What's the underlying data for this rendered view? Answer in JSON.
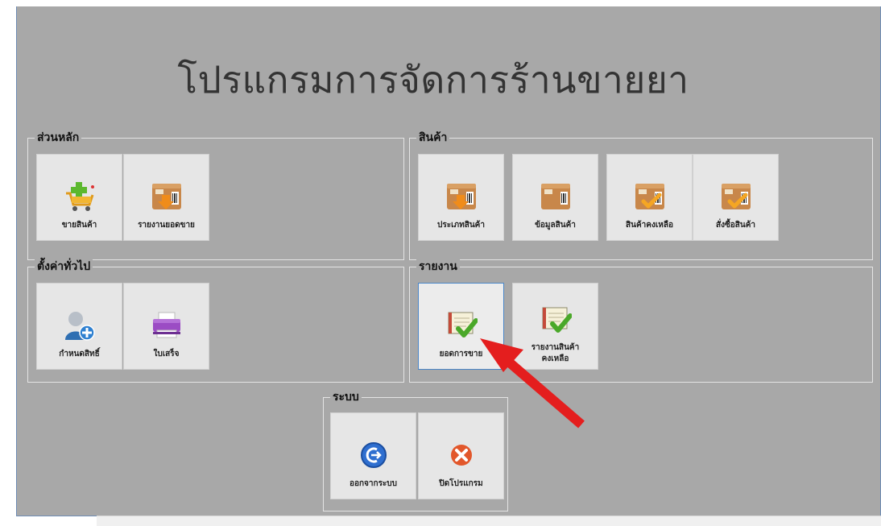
{
  "app": {
    "title": "โปรแกรมการจัดการร้านขายยา"
  },
  "groups": {
    "main": {
      "title": "ส่วนหลัก",
      "items": [
        {
          "label": "ขายสินค้า",
          "icon": "shopping-cart-add-icon"
        },
        {
          "label": "รายงานยอดขาย",
          "icon": "package-download-icon"
        }
      ]
    },
    "products": {
      "title": "สินค้า",
      "items": [
        {
          "label": "ประเภทสินค้า",
          "icon": "package-download-icon"
        },
        {
          "label": "ข้อมูลสินค้า",
          "icon": "package-icon"
        },
        {
          "label": "สินค้าคงเหลือ",
          "icon": "package-check-icon"
        },
        {
          "label": "สั่งซื้อสินค้า",
          "icon": "package-check-icon"
        }
      ]
    },
    "settings": {
      "title": "ตั้งค่าทั่วไป",
      "items": [
        {
          "label": "กำหนดสิทธิ์",
          "icon": "user-add-icon"
        },
        {
          "label": "ใบเสร็จ",
          "icon": "printer-icon"
        }
      ]
    },
    "reports": {
      "title": "รายงาน",
      "items": [
        {
          "label": "ยอดการขาย",
          "icon": "book-check-icon"
        },
        {
          "label_line1": "รายงานสินค้า",
          "label_line2": "คงเหลือ",
          "icon": "book-check-icon"
        }
      ]
    },
    "system": {
      "title": "ระบบ",
      "items": [
        {
          "label": "ออกจากระบบ",
          "icon": "logout-icon"
        },
        {
          "label": "ปิดโปรแกรม",
          "icon": "close-circle-icon"
        }
      ]
    }
  },
  "colors": {
    "window_bg": "#a8a8a8",
    "tile_bg": "#e6e6e6",
    "arrow": "#e41e1e",
    "selected_border": "#4a86c8"
  }
}
